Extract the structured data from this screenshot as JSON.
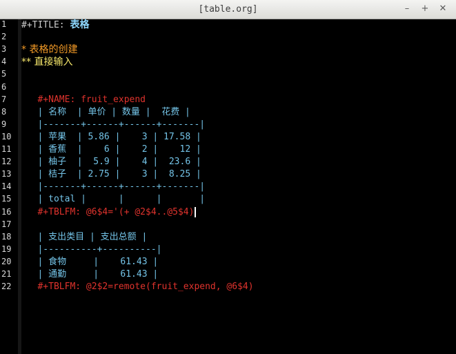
{
  "window": {
    "title": "[table.org]",
    "controls": [
      "minimize",
      "maximize",
      "close"
    ]
  },
  "editor": {
    "lines": [
      {
        "n": "1",
        "parts": [
          {
            "text": "#+TITLE: ",
            "cls": "kw"
          },
          {
            "text": "表格",
            "cls": "title-val"
          }
        ]
      },
      {
        "n": "2",
        "parts": []
      },
      {
        "n": "3",
        "parts": [
          {
            "text": "* 表格的创建",
            "cls": "h1"
          }
        ]
      },
      {
        "n": "4",
        "parts": [
          {
            "text": "** 直接输入",
            "cls": "h2"
          }
        ]
      },
      {
        "n": "5",
        "parts": []
      },
      {
        "n": "6",
        "parts": []
      },
      {
        "n": "7",
        "parts": [
          {
            "text": "   #+NAME: fruit_expend",
            "cls": "meta"
          }
        ]
      },
      {
        "n": "8",
        "parts": [
          {
            "text": "   | 名称  | 单价 | 数量 |  花费 |",
            "cls": "tbl"
          }
        ]
      },
      {
        "n": "9",
        "parts": [
          {
            "text": "   |-------+------+------+-------|",
            "cls": "tbl"
          }
        ]
      },
      {
        "n": "10",
        "parts": [
          {
            "text": "   | 苹果  | 5.86 |    3 | 17.58 |",
            "cls": "tbl"
          }
        ]
      },
      {
        "n": "11",
        "parts": [
          {
            "text": "   | 香蕉  |    6 |    2 |    12 |",
            "cls": "tbl"
          }
        ]
      },
      {
        "n": "12",
        "parts": [
          {
            "text": "   | 柚子  |  5.9 |    4 |  23.6 |",
            "cls": "tbl"
          }
        ]
      },
      {
        "n": "13",
        "parts": [
          {
            "text": "   | 桔子  | 2.75 |    3 |  8.25 |",
            "cls": "tbl"
          }
        ]
      },
      {
        "n": "14",
        "parts": [
          {
            "text": "   |-------+------+------+-------|",
            "cls": "tbl"
          }
        ]
      },
      {
        "n": "15",
        "parts": [
          {
            "text": "   | total |      |      |       |",
            "cls": "tbl"
          }
        ]
      },
      {
        "n": "16",
        "parts": [
          {
            "text": "   #+TBLFM: @6$4='(+ @2$4..@5$4)",
            "cls": "meta"
          }
        ],
        "cursor": true
      },
      {
        "n": "17",
        "parts": []
      },
      {
        "n": "18",
        "parts": [
          {
            "text": "   | 支出类目 | 支出总额 |",
            "cls": "tbl"
          }
        ]
      },
      {
        "n": "19",
        "parts": [
          {
            "text": "   |----------+----------|",
            "cls": "tbl"
          }
        ]
      },
      {
        "n": "20",
        "parts": [
          {
            "text": "   | 食物     |    61.43 |",
            "cls": "tbl"
          }
        ]
      },
      {
        "n": "21",
        "parts": [
          {
            "text": "   | 通勤     |    61.43 |",
            "cls": "tbl"
          }
        ]
      },
      {
        "n": "22",
        "parts": [
          {
            "text": "   #+TBLFM: @2$2=remote(fruit_expend, @6$4)",
            "cls": "meta"
          }
        ]
      }
    ]
  }
}
